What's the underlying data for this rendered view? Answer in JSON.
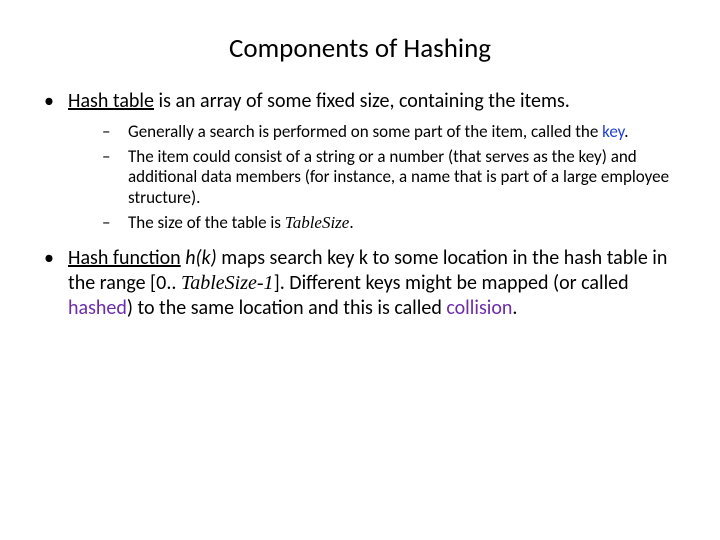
{
  "title": "Components of Hashing",
  "b1": {
    "pre": "",
    "hash_table": "Hash table",
    "rest": " is an array of some fixed size, containing the items."
  },
  "b1s1": {
    "pre": "Generally a search is performed on some part of the item, called the ",
    "key": "key",
    "post": "."
  },
  "b1s2": "The item could consist of a string or a number (that serves as the key) and additional data members (for instance, a name that is part of a large employee structure).",
  "b1s3": {
    "pre": "The size of the table is ",
    "ts": "TableSize",
    "post": "."
  },
  "b2": {
    "hf_label": "Hash function",
    "hf_sym": "h(k)",
    "mid1": " maps search key k to some location in the hash table in the range [0.. ",
    "range_end": "TableSize-1",
    "mid2": "].  Different keys might be mapped (or called ",
    "hashed": "hashed",
    "mid3": ") to the same location and this is called ",
    "collision": "collision",
    "post": "."
  }
}
